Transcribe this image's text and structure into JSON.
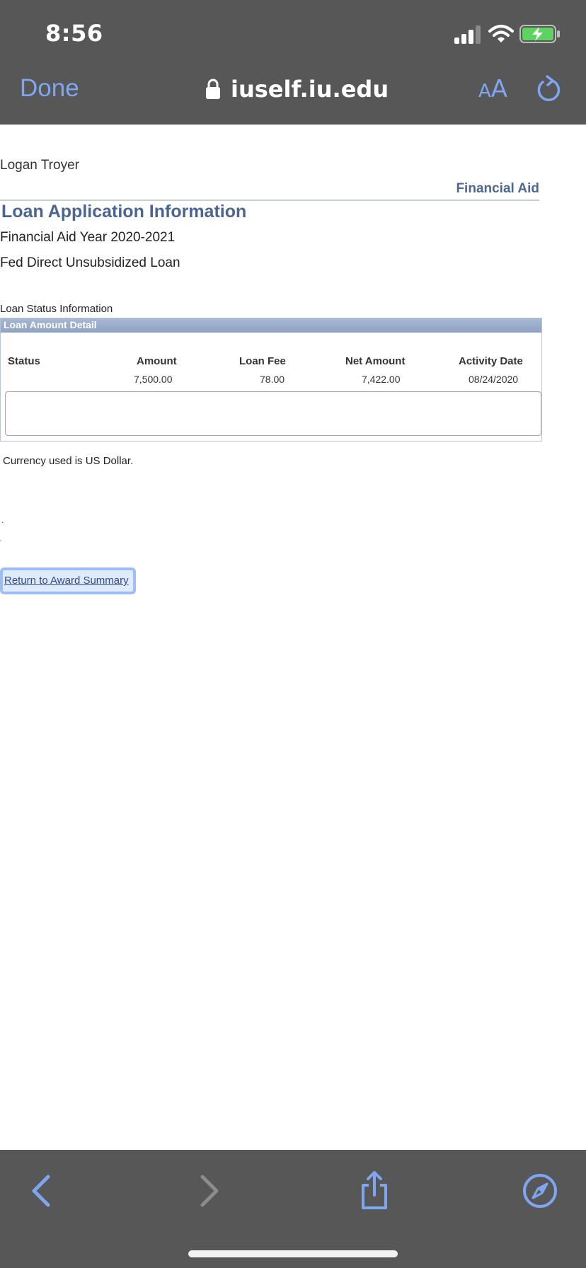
{
  "status_bar": {
    "time": "8:56"
  },
  "browser": {
    "done_label": "Done",
    "url": "iuself.iu.edu",
    "text_size_small": "A",
    "text_size_big": "A",
    "accent_color": "#7fa6f0"
  },
  "page": {
    "user_name": "Logan Troyer",
    "section_link": "Financial Aid",
    "title": "Loan Application Information",
    "aid_year": "Financial Aid Year 2020-2021",
    "loan_type": "Fed Direct Unsubsidized Loan",
    "status_info_label": "Loan Status Information",
    "loan_box": {
      "header": "Loan Amount Detail",
      "columns": [
        "Status",
        "Amount",
        "Loan Fee",
        "Net Amount",
        "Activity Date"
      ],
      "row": {
        "status": "",
        "amount": "7,500.00",
        "loan_fee": "78.00",
        "net_amount": "7,422.00",
        "activity_date": "08/24/2020"
      }
    },
    "currency_note": "Currency used is US Dollar.",
    "dot1": ".",
    "dot2": "'",
    "return_link": "Return to Award Summary"
  },
  "toolbar": {
    "icons": [
      "back-icon",
      "forward-icon",
      "share-icon",
      "compass-icon"
    ]
  }
}
